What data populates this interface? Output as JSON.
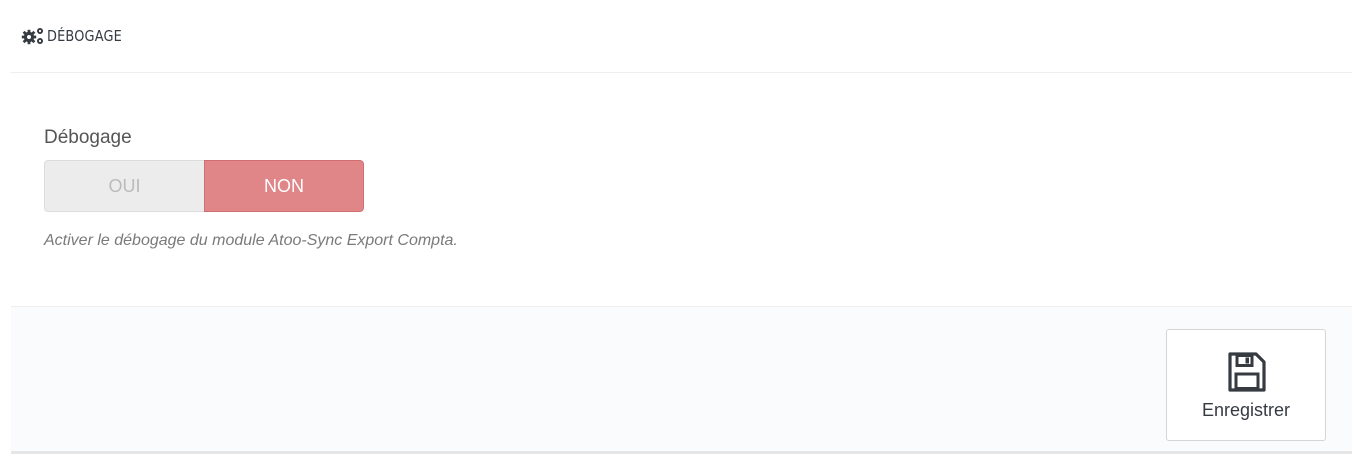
{
  "panel": {
    "heading_title": "DÉBOGAGE",
    "heading_icon": "cogs-icon"
  },
  "debug_field": {
    "label": "Débogage",
    "switch": {
      "options": [
        "OUI",
        "NON"
      ],
      "selected": "NON"
    },
    "help_text": "Activer le débogage du module Atoo-Sync Export Compta."
  },
  "footer": {
    "save_label": "Enregistrer",
    "save_icon": "save-icon"
  },
  "colors": {
    "switch_selected_bg": "#e08588",
    "switch_unselected_bg": "#ececec",
    "footer_bg": "#fafbfc"
  }
}
